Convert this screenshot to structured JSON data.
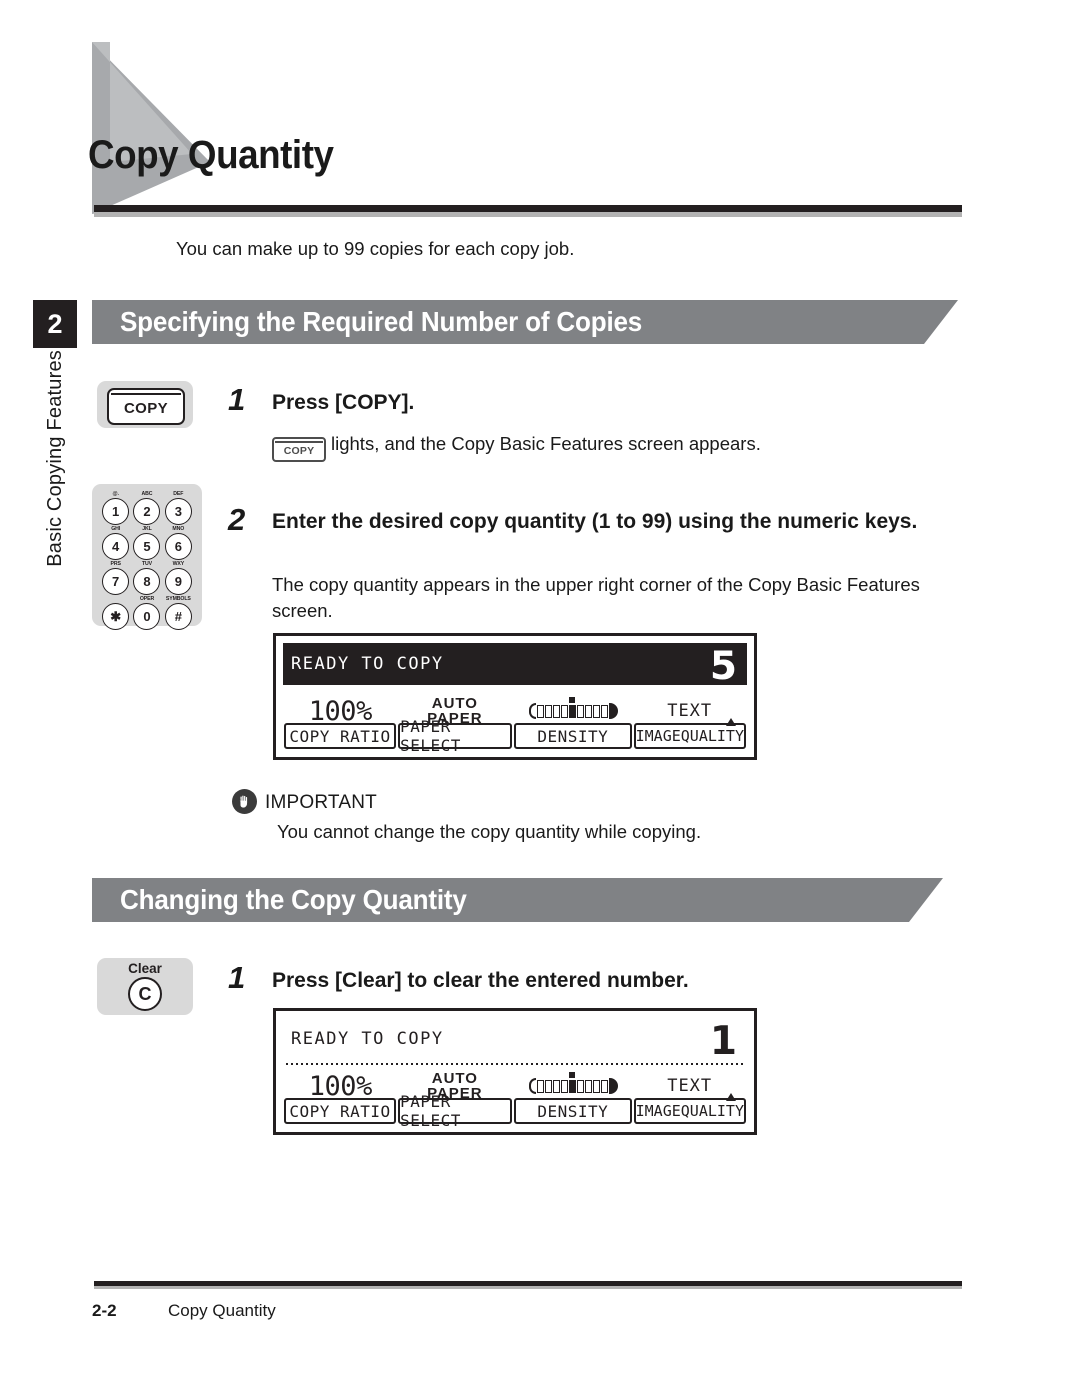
{
  "chapter": {
    "title": "Copy Quantity",
    "intro": "You can make up to 99 copies for each copy job.",
    "tab_number": "2",
    "tab_label": "Basic Copying Features"
  },
  "sections": [
    {
      "heading": "Specifying the Required Number of Copies",
      "steps": [
        {
          "number": "1",
          "heading": "Press [COPY].",
          "body_badge": "COPY",
          "body": "lights, and the Copy Basic Features screen appears."
        },
        {
          "number": "2",
          "heading": "Enter the desired copy quantity (1 to 99) using the numeric keys.",
          "body": "The copy quantity appears in the upper right corner of the Copy Basic Features screen."
        }
      ]
    },
    {
      "heading": "Changing the Copy Quantity",
      "steps": [
        {
          "number": "1",
          "heading": "Press [Clear] to clear the entered number."
        }
      ]
    }
  ],
  "keys": {
    "copy_button_label": "COPY",
    "clear_button_top_label": "Clear",
    "clear_button_glyph": "C"
  },
  "keypad": {
    "rows": [
      [
        {
          "sub": "@.",
          "digit": "1"
        },
        {
          "sub": "ABC",
          "digit": "2"
        },
        {
          "sub": "DEF",
          "digit": "3"
        }
      ],
      [
        {
          "sub": "GHI",
          "digit": "4"
        },
        {
          "sub": "JKL",
          "digit": "5"
        },
        {
          "sub": "MNO",
          "digit": "6"
        }
      ],
      [
        {
          "sub": "PRS",
          "digit": "7"
        },
        {
          "sub": "TUV",
          "digit": "8"
        },
        {
          "sub": "WXY",
          "digit": "9"
        }
      ],
      [
        {
          "sub": "",
          "digit": "✱"
        },
        {
          "sub": "OPER",
          "digit": "0"
        },
        {
          "sub": "SYMBOLS",
          "digit": "#"
        }
      ]
    ]
  },
  "lcd_screens": [
    {
      "status": "READY TO COPY",
      "quantity": "5",
      "inverted_topbar": true,
      "copy_ratio_value": "100%",
      "paper_select_line1": "AUTO",
      "paper_select_line2": "PAPER",
      "image_quality_value": "TEXT",
      "softkeys": [
        "COPY RATIO",
        "PAPER SELECT",
        "DENSITY",
        "IMAGEQUALITY"
      ]
    },
    {
      "status": "READY TO COPY",
      "quantity": "1",
      "inverted_topbar": false,
      "copy_ratio_value": "100%",
      "paper_select_line1": "AUTO",
      "paper_select_line2": "PAPER",
      "image_quality_value": "TEXT",
      "softkeys": [
        "COPY RATIO",
        "PAPER SELECT",
        "DENSITY",
        "IMAGEQUALITY"
      ]
    }
  ],
  "note": {
    "title": "IMPORTANT",
    "body": "You cannot change the copy quantity while copying.",
    "icon": "hand-icon"
  },
  "footer": {
    "page_number": "2-2",
    "running_title": "Copy Quantity"
  },
  "colors": {
    "section_bar": "#808285",
    "rule_dark": "#231f20",
    "rule_light": "#b3b3b3",
    "key_background": "#d9d9d9",
    "tab_background": "#231f20"
  }
}
